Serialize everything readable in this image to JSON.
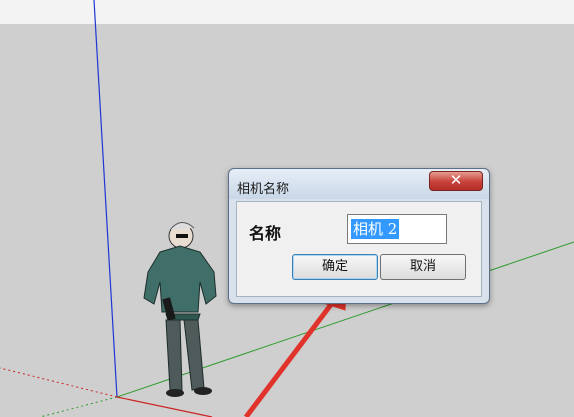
{
  "dialog": {
    "title": "相机名称",
    "close_glyph": "✕",
    "name_label": "名称",
    "name_value": "相机 2",
    "ok_label": "确定",
    "cancel_label": "取消"
  },
  "colors": {
    "background": "#cfcfcf",
    "sky": "#f3f3f3",
    "blue_axis": "#1f36d6",
    "green_axis": "#2e9b2e",
    "red_axis": "#cc2222",
    "arrow": "#e0332b",
    "selection": "#3399ff",
    "close_button": "#c7403a"
  },
  "scene": {
    "figure": "person-figure",
    "annotation": "red-arrow-pointing-to-ok"
  }
}
